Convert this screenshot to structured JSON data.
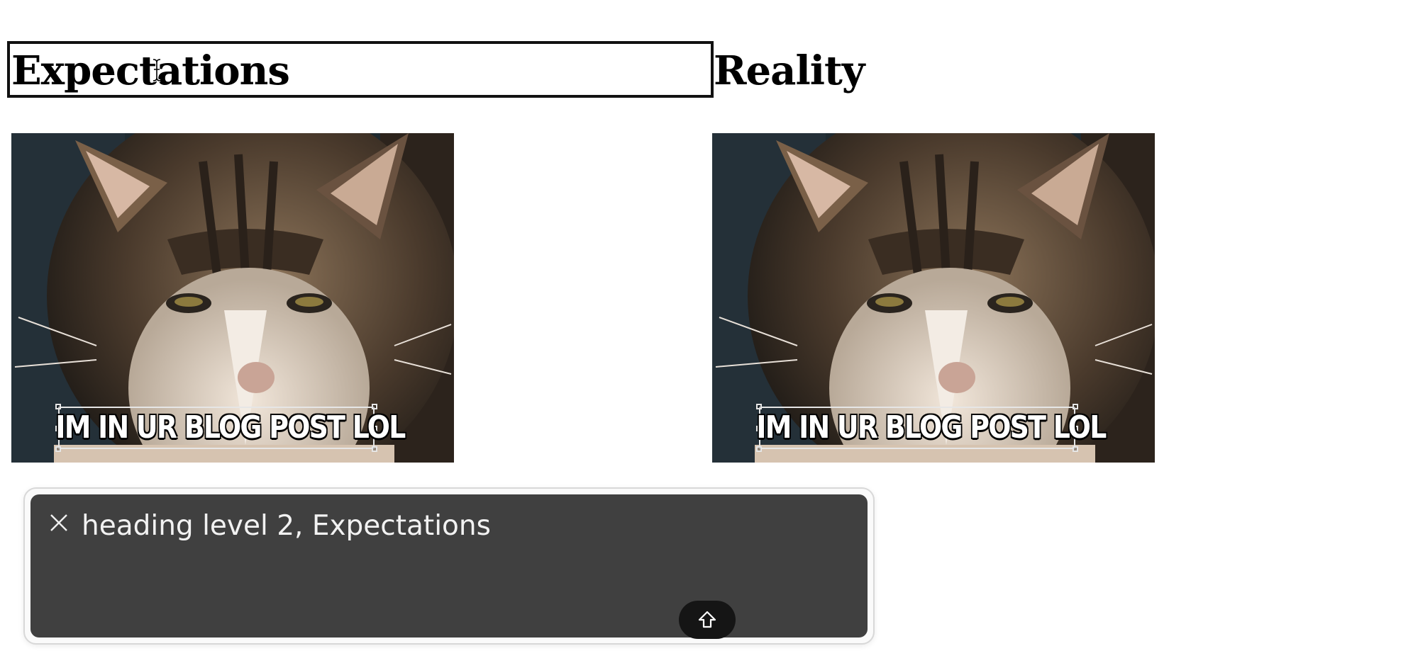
{
  "left_heading": "Expectations",
  "right_heading": "Reality",
  "meme_caption": "IM IN UR BLOG POST LOL",
  "voiceover": {
    "spoken_text": "heading level 2, Expectations",
    "close_icon": "close-icon",
    "expand_icon": "arrow-up-outline-icon"
  },
  "colors": {
    "panel_bg": "#404040",
    "panel_border": "#d8d8d8",
    "focus_ring": "#111111"
  }
}
